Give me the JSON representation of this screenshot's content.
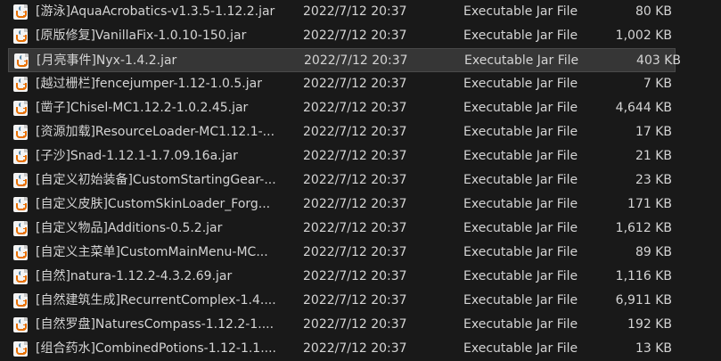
{
  "files": [
    {
      "name": "[游泳]AquaAcrobatics-v1.3.5-1.12.2.jar",
      "date": "2022/7/12 20:37",
      "type": "Executable Jar File",
      "size": "80 KB",
      "icon": "java-jar-icon"
    },
    {
      "name": "[原版修复]VanillaFix-1.0.10-150.jar",
      "date": "2022/7/12 20:37",
      "type": "Executable Jar File",
      "size": "1,002 KB",
      "icon": "java-jar-icon"
    },
    {
      "name": "[月亮事件]Nyx-1.4.2.jar",
      "date": "2022/7/12 20:37",
      "type": "Executable Jar File",
      "size": "403 KB",
      "icon": "java-jar-icon",
      "selected": true
    },
    {
      "name": "[越过栅栏]fencejumper-1.12-1.0.5.jar",
      "date": "2022/7/12 20:37",
      "type": "Executable Jar File",
      "size": "7 KB",
      "icon": "java-jar-icon"
    },
    {
      "name": "[凿子]Chisel-MC1.12.2-1.0.2.45.jar",
      "date": "2022/7/12 20:37",
      "type": "Executable Jar File",
      "size": "4,644 KB",
      "icon": "java-jar-icon"
    },
    {
      "name": "[资源加载]ResourceLoader-MC1.12.1-...",
      "date": "2022/7/12 20:37",
      "type": "Executable Jar File",
      "size": "17 KB",
      "icon": "java-jar-icon"
    },
    {
      "name": "[子沙]Snad-1.12.1-1.7.09.16a.jar",
      "date": "2022/7/12 20:37",
      "type": "Executable Jar File",
      "size": "21 KB",
      "icon": "java-jar-icon"
    },
    {
      "name": "[自定义初始装备]CustomStartingGear-...",
      "date": "2022/7/12 20:37",
      "type": "Executable Jar File",
      "size": "23 KB",
      "icon": "java-jar-icon"
    },
    {
      "name": "[自定义皮肤]CustomSkinLoader_Forg...",
      "date": "2022/7/12 20:37",
      "type": "Executable Jar File",
      "size": "171 KB",
      "icon": "java-jar-icon"
    },
    {
      "name": "[自定义物品]Additions-0.5.2.jar",
      "date": "2022/7/12 20:37",
      "type": "Executable Jar File",
      "size": "1,612 KB",
      "icon": "java-jar-icon"
    },
    {
      "name": "[自定义主菜单]CustomMainMenu-MC...",
      "date": "2022/7/12 20:37",
      "type": "Executable Jar File",
      "size": "89 KB",
      "icon": "java-jar-icon"
    },
    {
      "name": "[自然]natura-1.12.2-4.3.2.69.jar",
      "date": "2022/7/12 20:37",
      "type": "Executable Jar File",
      "size": "1,116 KB",
      "icon": "java-jar-icon"
    },
    {
      "name": "[自然建筑生成]RecurrentComplex-1.4....",
      "date": "2022/7/12 20:37",
      "type": "Executable Jar File",
      "size": "6,911 KB",
      "icon": "java-jar-icon"
    },
    {
      "name": "[自然罗盘]NaturesCompass-1.12.2-1....",
      "date": "2022/7/12 20:37",
      "type": "Executable Jar File",
      "size": "192 KB",
      "icon": "java-jar-icon"
    },
    {
      "name": "[组合药水]CombinedPotions-1.12-1.1....",
      "date": "2022/7/12 20:37",
      "type": "Executable Jar File",
      "size": "13 KB",
      "icon": "java-jar-icon"
    }
  ]
}
